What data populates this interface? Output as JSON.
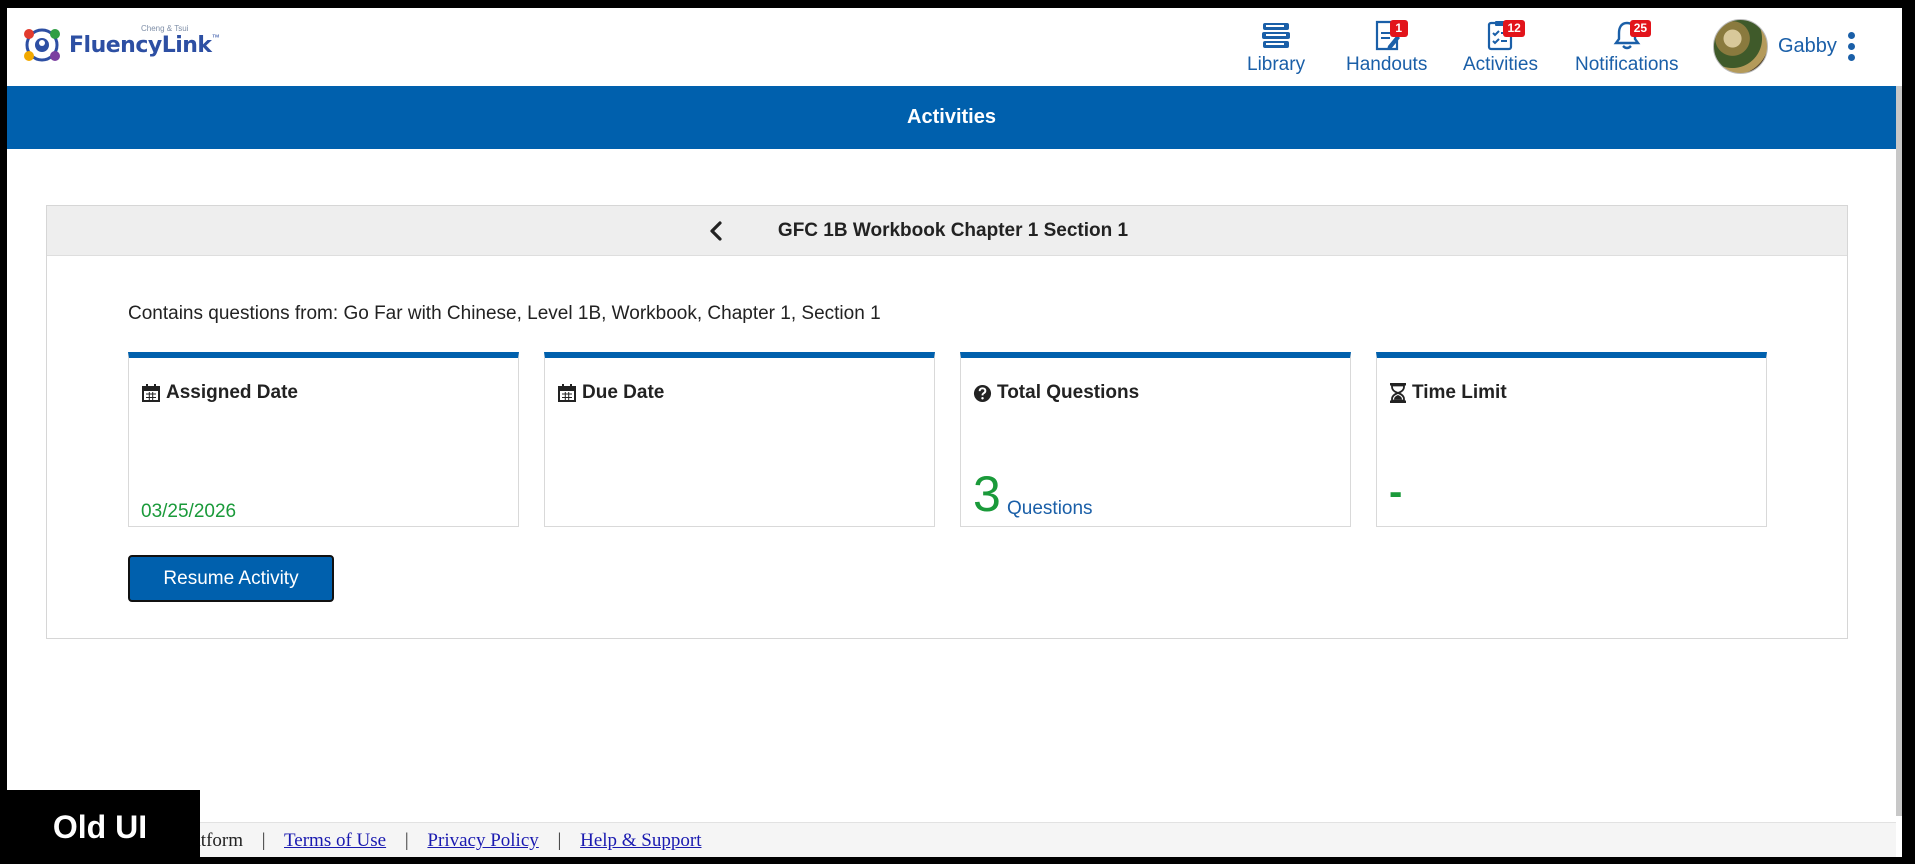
{
  "brand": {
    "name": "FluencyLink",
    "tm": "™",
    "sub": "Cheng & Tsui"
  },
  "nav": {
    "library": {
      "label": "Library",
      "icon": "books-icon"
    },
    "handouts": {
      "label": "Handouts",
      "icon": "document-edit-icon",
      "badge": "1"
    },
    "activities": {
      "label": "Activities",
      "icon": "checklist-icon",
      "badge": "12"
    },
    "notifications": {
      "label": "Notifications",
      "icon": "bell-icon",
      "badge": "25"
    }
  },
  "user": {
    "name": "Gabby"
  },
  "page": {
    "title": "Activities"
  },
  "activity": {
    "title": "GFC 1B Workbook Chapter 1 Section 1",
    "contains": "Contains questions from: Go Far with Chinese, Level 1B, Workbook, Chapter 1, Section 1",
    "cards": {
      "assigned": {
        "label": "Assigned Date",
        "value": "03/25/2026"
      },
      "due": {
        "label": "Due Date",
        "value": ""
      },
      "total": {
        "label": "Total Questions",
        "count": "3",
        "unit": "Questions"
      },
      "time": {
        "label": "Time Limit",
        "value": "-"
      }
    },
    "resume_label": "Resume Activity"
  },
  "footer": {
    "platform_text": "ning Platform",
    "sep": "|",
    "terms": "Terms of Use",
    "privacy": "Privacy Policy",
    "help": "Help & Support"
  },
  "overlay_label": "Old UI",
  "colors": {
    "primary": "#0060ad",
    "link": "#1a5fa8",
    "success": "#1a9a3a",
    "badge": "#e2141b"
  }
}
